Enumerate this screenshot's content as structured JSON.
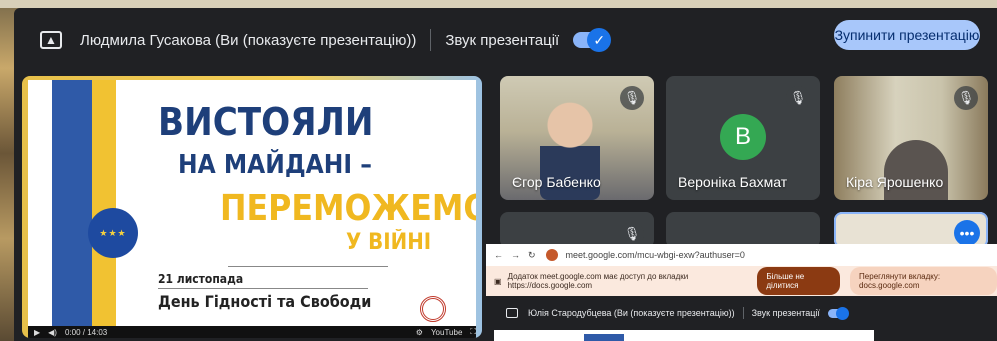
{
  "topbar": {
    "presenter_text": "Людмила Гусакова (Ви (показуєте презентацію))",
    "sound_label": "Звук презентації",
    "stop_button": "Зупинити презентацію"
  },
  "slide": {
    "line1": "ВИСТОЯЛИ",
    "line2": "НА МАЙДАНІ –",
    "line3": "ПЕРЕМОЖЕМО",
    "line4": "У ВІЙНІ",
    "date": "21 листопада",
    "holiday": "День Гідності та Свободи",
    "player_time": "0:00 / 14:03",
    "player_brand": "YouTube"
  },
  "participants": [
    {
      "name": "Єгор Бабенко",
      "muted": true
    },
    {
      "name": "Вероніка Бахмат",
      "initial": "В",
      "avatar_color": "#34a853",
      "muted": true
    },
    {
      "name": "Кіра Ярошенко",
      "muted": true
    }
  ],
  "overlay": {
    "url": "meet.google.com/mcu-wbgi-exw?authuser=0",
    "notice": "Додаток meet.google.com має доступ до вкладки https://docs.google.com",
    "stop_sharing": "Більше не ділитися",
    "switch_tab": "Переглянути вкладку: docs.google.com",
    "presenter_text": "Юлія Стародубцева (Ви (показуєте презентацію))",
    "sound_label": "Звук презентації"
  }
}
